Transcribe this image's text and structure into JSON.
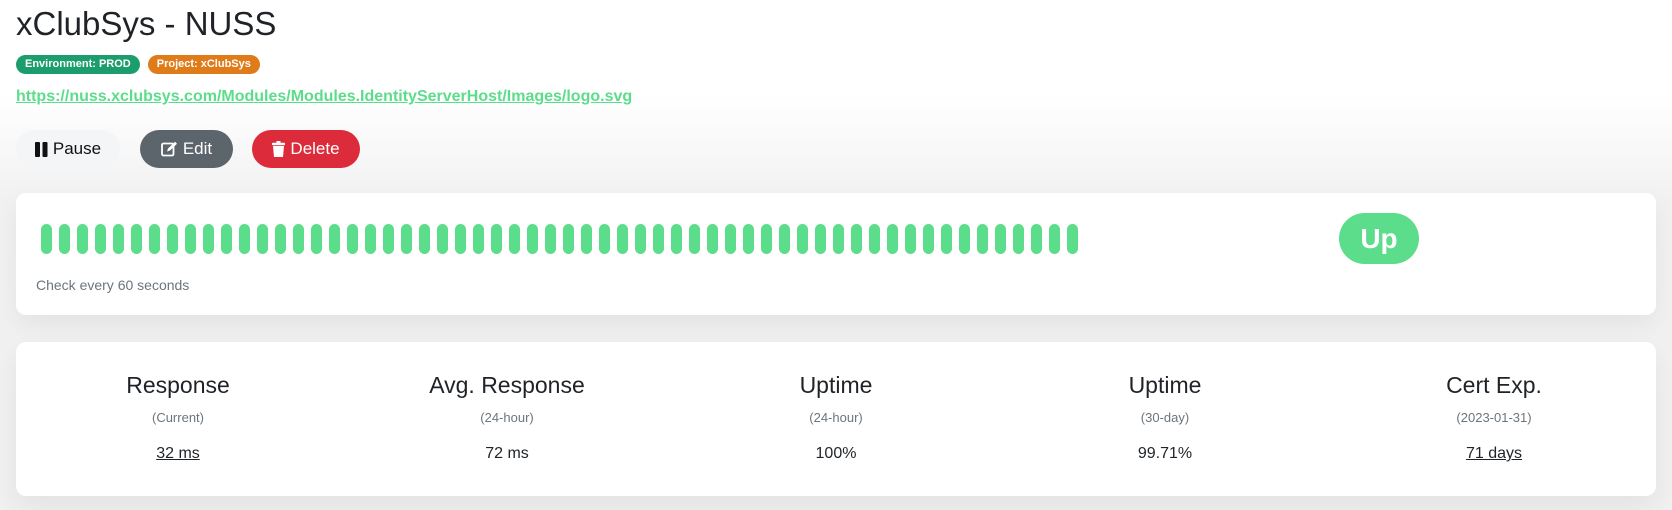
{
  "monitor": {
    "title": "xClubSys - NUSS",
    "tags": {
      "environment": "Environment: PROD",
      "project": "Project: xClubSys"
    },
    "url": "https://nuss.xclubsys.com/Modules/Modules.IdentityServerHost/Images/logo.svg"
  },
  "actions": {
    "pause_label": "Pause",
    "edit_label": "Edit",
    "delete_label": "Delete"
  },
  "heartbeat": {
    "beats_count": 58,
    "beat_status": "up",
    "check_interval_text": "Check every 60 seconds",
    "status_label": "Up"
  },
  "stats": [
    {
      "title": "Response",
      "subtitle": "(Current)",
      "value": "32 ms"
    },
    {
      "title": "Avg. Response",
      "subtitle": "(24-hour)",
      "value": "72 ms"
    },
    {
      "title": "Uptime",
      "subtitle": "(24-hour)",
      "value": "100%"
    },
    {
      "title": "Uptime",
      "subtitle": "(30-day)",
      "value": "99.71%"
    },
    {
      "title": "Cert Exp.",
      "subtitle": "(2023-01-31)",
      "value": "71 days"
    }
  ],
  "colors": {
    "up": "#5cdd8b",
    "environment_badge": "#1c9d6e",
    "project_badge": "#e07b1a",
    "edit_button": "#5c646c",
    "delete_button": "#dc2b3a"
  },
  "icons": {
    "pause": "pause-icon",
    "edit": "edit-icon",
    "delete": "trash-icon"
  }
}
